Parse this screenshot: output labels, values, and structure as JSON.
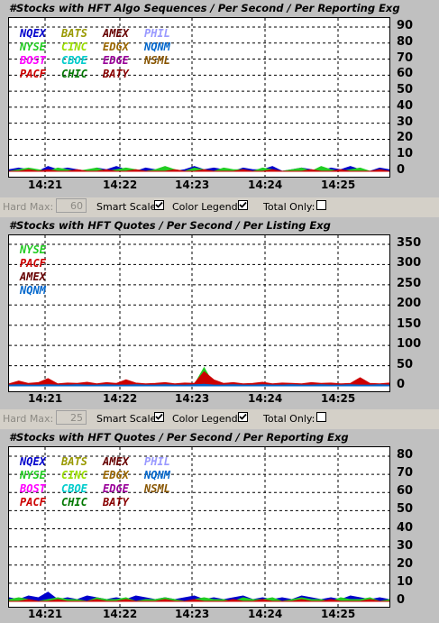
{
  "panels": [
    {
      "title": "#Stocks with HFT Algo Sequences / Per Second / Per Reporting Exg",
      "legend": [
        {
          "label": "NQEX",
          "color": "#0000cc"
        },
        {
          "label": "BATS",
          "color": "#999900"
        },
        {
          "label": "AMEX",
          "color": "#660000"
        },
        {
          "label": "PHIL",
          "color": "#9999ff"
        },
        {
          "label": "NYSE",
          "color": "#22cc22"
        },
        {
          "label": "CINC",
          "color": "#99dd00"
        },
        {
          "label": "EDGX",
          "color": "#996600"
        },
        {
          "label": "NQNM",
          "color": "#0066cc"
        },
        {
          "label": "BOST",
          "color": "#ff00ff"
        },
        {
          "label": "CBOE",
          "color": "#00cccc"
        },
        {
          "label": "EDGE",
          "color": "#990099"
        },
        {
          "label": "NSML",
          "color": "#885500"
        },
        {
          "label": "PACF",
          "color": "#cc0000"
        },
        {
          "label": "CHIC",
          "color": "#007700"
        },
        {
          "label": "BATY",
          "color": "#880000"
        }
      ],
      "y_ticks": [
        "90",
        "80",
        "70",
        "60",
        "50",
        "40",
        "30",
        "20",
        "10",
        "0"
      ],
      "x_ticks": [
        "14:21",
        "14:22",
        "14:23",
        "14:24",
        "14:25"
      ]
    },
    {
      "title": "#Stocks with HFT Quotes / Per Second / Per Listing Exg",
      "legend": [
        {
          "label": "NYSE",
          "color": "#22cc22"
        },
        {
          "label": "PACF",
          "color": "#cc0000"
        },
        {
          "label": "AMEX",
          "color": "#660000"
        },
        {
          "label": "NQNM",
          "color": "#0066cc"
        }
      ],
      "y_ticks": [
        "350",
        "300",
        "250",
        "200",
        "150",
        "100",
        "50",
        "0"
      ],
      "x_ticks": [
        "14:21",
        "14:22",
        "14:23",
        "14:24",
        "14:25"
      ]
    },
    {
      "title": "#Stocks with HFT Quotes / Per Second / Per Reporting Exg",
      "legend": [
        {
          "label": "NQEX",
          "color": "#0000cc"
        },
        {
          "label": "BATS",
          "color": "#999900"
        },
        {
          "label": "AMEX",
          "color": "#660000"
        },
        {
          "label": "PHIL",
          "color": "#9999ff"
        },
        {
          "label": "NYSE",
          "color": "#22cc22"
        },
        {
          "label": "CINC",
          "color": "#99dd00"
        },
        {
          "label": "EDGX",
          "color": "#996600"
        },
        {
          "label": "NQNM",
          "color": "#0066cc"
        },
        {
          "label": "BOST",
          "color": "#ff00ff"
        },
        {
          "label": "CBOE",
          "color": "#00cccc"
        },
        {
          "label": "EDGE",
          "color": "#990099"
        },
        {
          "label": "NSML",
          "color": "#885500"
        },
        {
          "label": "PACF",
          "color": "#cc0000"
        },
        {
          "label": "CHIC",
          "color": "#007700"
        },
        {
          "label": "BATY",
          "color": "#880000"
        }
      ],
      "y_ticks": [
        "80",
        "70",
        "60",
        "50",
        "40",
        "30",
        "20",
        "10",
        "0"
      ],
      "x_ticks": [
        "14:21",
        "14:22",
        "14:23",
        "14:24",
        "14:25"
      ]
    }
  ],
  "controls": [
    {
      "hard_max_label": "Hard Max:",
      "hard_max_value": "60",
      "smart_scale_label": "Smart Scale:",
      "smart_scale_checked": true,
      "color_legend_label": "Color Legend:",
      "color_legend_checked": true,
      "total_only_label": "Total Only:",
      "total_only_checked": false
    },
    {
      "hard_max_label": "Hard Max:",
      "hard_max_value": "25",
      "smart_scale_label": "Smart Scale:",
      "smart_scale_checked": true,
      "color_legend_label": "Color Legend:",
      "color_legend_checked": true,
      "total_only_label": "Total Only:",
      "total_only_checked": false
    }
  ],
  "chart_data": [
    {
      "type": "area",
      "title": "#Stocks with HFT Algo Sequences / Per Second / Per Reporting Exg",
      "xlabel": "",
      "ylabel": "",
      "ylim": [
        0,
        90
      ],
      "x_ticks": [
        "14:21",
        "14:22",
        "14:23",
        "14:24",
        "14:25"
      ],
      "grid": true,
      "series": [
        {
          "name": "NQEX",
          "color": "#0000cc",
          "values": [
            1,
            2,
            1,
            0,
            3,
            1,
            2,
            1,
            0,
            2,
            1,
            3,
            1,
            0,
            2,
            1,
            2,
            0,
            1,
            3,
            1,
            2,
            1,
            0,
            2,
            1,
            1,
            3,
            0,
            1,
            2,
            1,
            0,
            2,
            1,
            3,
            1,
            0,
            2,
            1
          ]
        },
        {
          "name": "NYSE",
          "color": "#22cc22",
          "values": [
            0,
            1,
            2,
            1,
            0,
            2,
            1,
            0,
            1,
            2,
            0,
            1,
            2,
            1,
            0,
            1,
            3,
            1,
            0,
            2,
            1,
            0,
            2,
            1,
            1,
            0,
            2,
            1,
            0,
            1,
            2,
            0,
            3,
            1,
            0,
            1,
            2,
            0,
            1,
            0
          ]
        },
        {
          "name": "PACF",
          "color": "#cc0000",
          "values": [
            0,
            0,
            1,
            0,
            1,
            0,
            0,
            1,
            0,
            0,
            1,
            0,
            0,
            1,
            0,
            0,
            0,
            1,
            0,
            0,
            1,
            0,
            0,
            0,
            1,
            0,
            0,
            1,
            0,
            0,
            0,
            1,
            0,
            0,
            1,
            0,
            0,
            0,
            1,
            0
          ]
        }
      ]
    },
    {
      "type": "area",
      "title": "#Stocks with HFT Quotes / Per Second / Per Listing Exg",
      "xlabel": "",
      "ylabel": "",
      "ylim": [
        0,
        350
      ],
      "x_ticks": [
        "14:21",
        "14:22",
        "14:23",
        "14:24",
        "14:25"
      ],
      "grid": true,
      "series": [
        {
          "name": "NYSE",
          "color": "#22cc22",
          "values": [
            3,
            2,
            4,
            3,
            2,
            3,
            5,
            2,
            3,
            4,
            2,
            3,
            3,
            2,
            4,
            3,
            2,
            3,
            4,
            3,
            45,
            3,
            2,
            3,
            4,
            2,
            3,
            3,
            2,
            4,
            3,
            2,
            3,
            4,
            2,
            3,
            3,
            2,
            4,
            3
          ]
        },
        {
          "name": "PACF",
          "color": "#cc0000",
          "values": [
            5,
            12,
            6,
            8,
            18,
            5,
            7,
            6,
            9,
            5,
            8,
            6,
            15,
            7,
            5,
            6,
            8,
            5,
            7,
            6,
            35,
            15,
            6,
            8,
            5,
            6,
            9,
            5,
            7,
            6,
            5,
            8,
            6,
            7,
            5,
            6,
            20,
            6,
            5,
            7
          ]
        },
        {
          "name": "AMEX",
          "color": "#660000",
          "values": [
            1,
            1,
            0,
            1,
            1,
            0,
            1,
            1,
            0,
            1,
            1,
            0,
            1,
            1,
            0,
            1,
            1,
            0,
            1,
            1,
            2,
            1,
            0,
            1,
            1,
            0,
            1,
            1,
            0,
            1,
            1,
            0,
            1,
            1,
            0,
            1,
            1,
            0,
            1,
            1
          ]
        },
        {
          "name": "NQNM",
          "color": "#0066cc",
          "values": [
            2,
            3,
            2,
            2,
            3,
            2,
            2,
            3,
            2,
            2,
            3,
            2,
            2,
            3,
            2,
            2,
            3,
            2,
            2,
            3,
            4,
            2,
            2,
            3,
            2,
            2,
            3,
            2,
            2,
            3,
            2,
            2,
            3,
            2,
            2,
            3,
            2,
            2,
            3,
            2
          ]
        }
      ]
    },
    {
      "type": "area",
      "title": "#Stocks with HFT Quotes / Per Second / Per Reporting Exg",
      "xlabel": "",
      "ylabel": "",
      "ylim": [
        0,
        80
      ],
      "x_ticks": [
        "14:21",
        "14:22",
        "14:23",
        "14:24",
        "14:25"
      ],
      "grid": true,
      "series": [
        {
          "name": "NQEX",
          "color": "#0000cc",
          "values": [
            2,
            1,
            3,
            2,
            5,
            1,
            2,
            1,
            3,
            2,
            1,
            2,
            1,
            3,
            2,
            1,
            2,
            1,
            2,
            3,
            1,
            2,
            1,
            2,
            3,
            1,
            2,
            1,
            2,
            1,
            3,
            2,
            1,
            2,
            1,
            3,
            2,
            1,
            2,
            1
          ]
        },
        {
          "name": "NYSE",
          "color": "#22cc22",
          "values": [
            1,
            2,
            1,
            0,
            1,
            2,
            1,
            1,
            0,
            2,
            1,
            1,
            2,
            0,
            1,
            1,
            2,
            1,
            0,
            1,
            2,
            1,
            1,
            0,
            2,
            1,
            1,
            2,
            0,
            1,
            2,
            1,
            1,
            0,
            2,
            1,
            1,
            2,
            0,
            1
          ]
        },
        {
          "name": "PACF",
          "color": "#cc0000",
          "values": [
            0,
            0,
            1,
            0,
            0,
            1,
            0,
            0,
            0,
            1,
            0,
            0,
            1,
            0,
            0,
            0,
            1,
            0,
            0,
            1,
            0,
            0,
            0,
            1,
            0,
            0,
            1,
            0,
            0,
            0,
            1,
            0,
            0,
            1,
            0,
            0,
            0,
            1,
            0,
            0
          ]
        }
      ]
    }
  ]
}
